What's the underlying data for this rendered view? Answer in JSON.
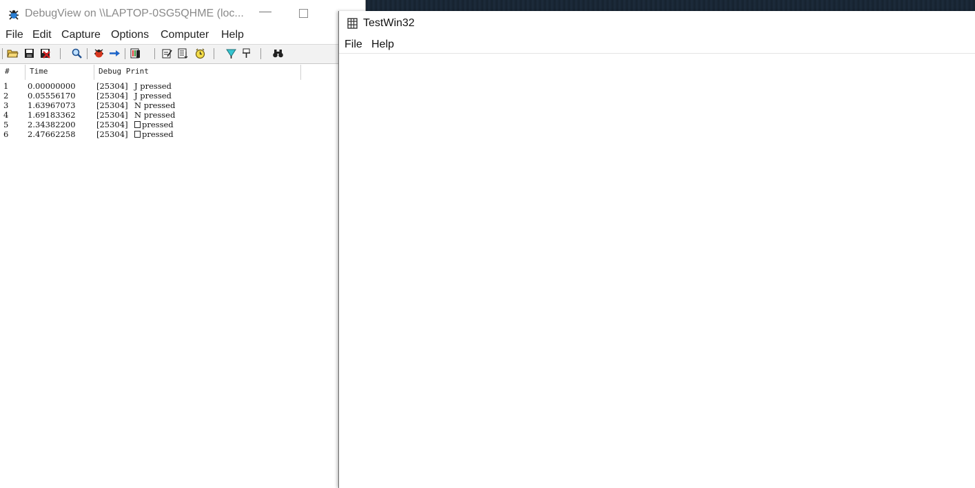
{
  "debugview": {
    "title": "DebugView on \\\\LAPTOP-0SG5QHME (loc...",
    "menu": [
      "File",
      "Edit",
      "Capture",
      "Options",
      "Computer",
      "Help"
    ],
    "toolbar_icons": [
      "open-icon",
      "save-icon",
      "clear-icon",
      "find-icon",
      "capture-icon",
      "autoscroll-icon",
      "filter-icon",
      "timestamp-icon",
      "clock-icon",
      "highlight-icon",
      "history-icon",
      "binoculars-icon"
    ],
    "columns": [
      "#",
      "Time",
      "Debug Print"
    ],
    "rows": [
      {
        "num": "1",
        "time": "0.00000000",
        "pid": "[25304]",
        "text": "J pressed",
        "box": false
      },
      {
        "num": "2",
        "time": "0.05556170",
        "pid": "[25304]",
        "text": "J pressed",
        "box": false
      },
      {
        "num": "3",
        "time": "1.63967073",
        "pid": "[25304]",
        "text": "N pressed",
        "box": false
      },
      {
        "num": "4",
        "time": "1.69183362",
        "pid": "[25304]",
        "text": "N pressed",
        "box": false
      },
      {
        "num": "5",
        "time": "2.34382200",
        "pid": "[25304]",
        "text": "pressed",
        "box": true
      },
      {
        "num": "6",
        "time": "2.47662258",
        "pid": "[25304]",
        "text": "pressed",
        "box": true
      }
    ]
  },
  "testwin": {
    "title": "TestWin32",
    "menu": [
      "File",
      "Help"
    ]
  }
}
